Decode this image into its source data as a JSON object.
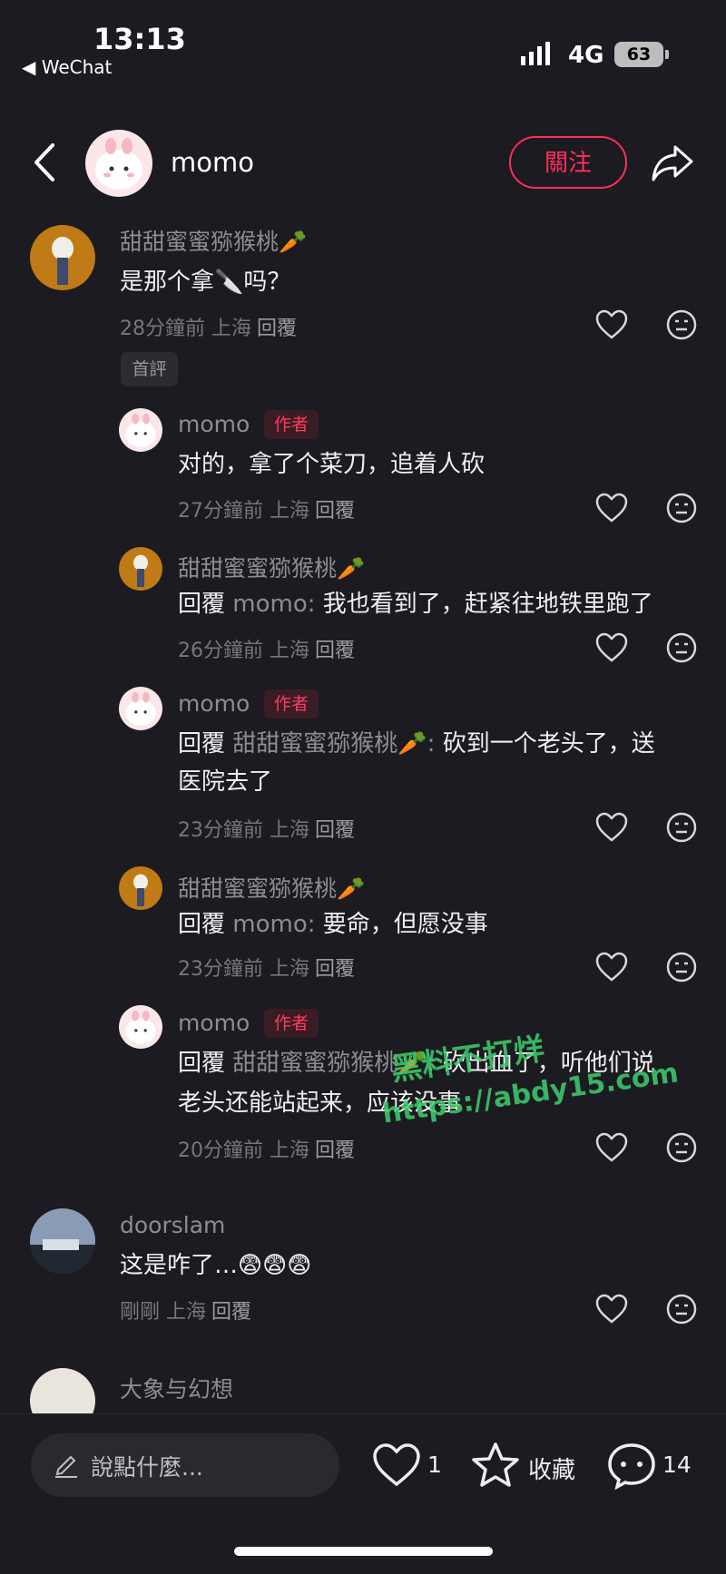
{
  "status_bar": {
    "time": "13:13",
    "back_app": "◀ WeChat",
    "network": "4G",
    "battery": "63"
  },
  "header": {
    "username": "momo",
    "follow_label": "關注"
  },
  "comments": [
    {
      "user": "甜甜蜜蜜猕猴桃🥕",
      "text": "是那个拿🔪吗？",
      "time": "28分鐘前 上海",
      "reply": "回覆",
      "badge": "首評"
    },
    {
      "user": "momo",
      "author_badge": "作者",
      "text": "对的，拿了个菜刀，追着人砍",
      "time": "27分鐘前 上海",
      "reply": "回覆"
    },
    {
      "user": "甜甜蜜蜜猕猴桃🥕",
      "reply_prefix": "回覆",
      "reply_to": "momo:",
      "text": "我也看到了，赶紧往地铁里跑了",
      "time": "26分鐘前 上海",
      "reply": "回覆"
    },
    {
      "user": "momo",
      "author_badge": "作者",
      "reply_prefix": "回覆",
      "reply_to": "甜甜蜜蜜猕猴桃🥕:",
      "text_line1": "砍到一个老头了，送",
      "text_line2": "医院去了",
      "time": "23分鐘前 上海",
      "reply": "回覆"
    },
    {
      "user": "甜甜蜜蜜猕猴桃🥕",
      "reply_prefix": "回覆",
      "reply_to": "momo:",
      "text": "要命，但愿没事",
      "time": "23分鐘前 上海",
      "reply": "回覆"
    },
    {
      "user": "momo",
      "author_badge": "作者",
      "reply_prefix": "回覆",
      "reply_to": "甜甜蜜蜜猕猴桃🥕:",
      "text_line1": "砍出血了，听他们说",
      "text_line2": "老头还能站起来，应该没事",
      "time": "20分鐘前 上海",
      "reply": "回覆"
    },
    {
      "user": "doorslam",
      "text": "这是咋了…😨😨😨",
      "time": "剛剛 上海",
      "reply": "回覆"
    },
    {
      "user": "大象与幻想"
    }
  ],
  "watermark": {
    "line1": "黑料不打烊",
    "line2": "https://abdy15.com"
  },
  "bottom_bar": {
    "input_placeholder": "說點什麼...",
    "like_count": "1",
    "collect_label": "收藏",
    "comment_count": "14"
  },
  "colors": {
    "background": "#1c1b21",
    "accent": "#ff2f5a",
    "watermark": "#3ecf6e"
  }
}
